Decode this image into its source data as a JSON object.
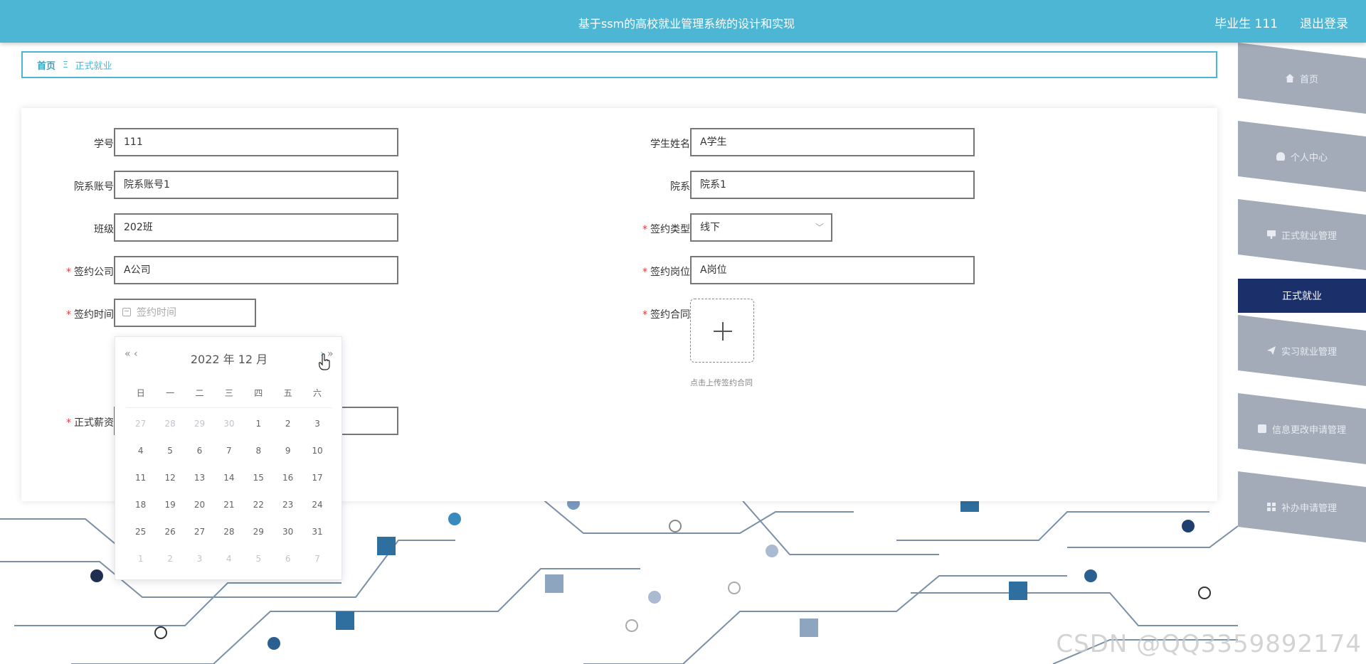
{
  "header": {
    "title": "基于ssm的高校就业管理系统的设计和实现",
    "user": "毕业生 111",
    "logout": "退出登录"
  },
  "breadcrumb": {
    "home": "首页",
    "separator": "Ξ",
    "current": "正式就业"
  },
  "form": {
    "student_no_label": "学号",
    "student_no": "111",
    "student_name_label": "学生姓名",
    "student_name": "A学生",
    "dept_account_label": "院系账号",
    "dept_account": "院系账号1",
    "dept_label": "院系",
    "dept": "院系1",
    "class_label": "班级",
    "class": "202班",
    "sign_type_label": "签约类型",
    "sign_type": "线下",
    "sign_company_label": "签约公司",
    "sign_company": "A公司",
    "sign_position_label": "签约岗位",
    "sign_position": "A岗位",
    "sign_time_label": "签约时间",
    "sign_time_placeholder": "签约时间",
    "contract_label": "签约合同",
    "contract_tip": "点击上传签约合同",
    "salary_label": "正式薪资",
    "required_mark": "*"
  },
  "datepicker": {
    "prev_year": "«",
    "prev_month": "‹",
    "next_month": "›",
    "next_year": "»",
    "title": "2022 年  12 月",
    "weekdays": [
      "日",
      "一",
      "二",
      "三",
      "四",
      "五",
      "六"
    ],
    "days": [
      {
        "d": "27",
        "muted": true
      },
      {
        "d": "28",
        "muted": true
      },
      {
        "d": "29",
        "muted": true
      },
      {
        "d": "30",
        "muted": true
      },
      {
        "d": "1"
      },
      {
        "d": "2"
      },
      {
        "d": "3"
      },
      {
        "d": "4"
      },
      {
        "d": "5"
      },
      {
        "d": "6"
      },
      {
        "d": "7"
      },
      {
        "d": "8"
      },
      {
        "d": "9"
      },
      {
        "d": "10"
      },
      {
        "d": "11"
      },
      {
        "d": "12"
      },
      {
        "d": "13"
      },
      {
        "d": "14"
      },
      {
        "d": "15"
      },
      {
        "d": "16"
      },
      {
        "d": "17"
      },
      {
        "d": "18"
      },
      {
        "d": "19"
      },
      {
        "d": "20"
      },
      {
        "d": "21"
      },
      {
        "d": "22"
      },
      {
        "d": "23"
      },
      {
        "d": "24"
      },
      {
        "d": "25"
      },
      {
        "d": "26"
      },
      {
        "d": "27"
      },
      {
        "d": "28"
      },
      {
        "d": "29"
      },
      {
        "d": "30"
      },
      {
        "d": "31"
      },
      {
        "d": "1",
        "muted": true
      },
      {
        "d": "2",
        "muted": true
      },
      {
        "d": "3",
        "muted": true
      },
      {
        "d": "4",
        "muted": true
      },
      {
        "d": "5",
        "muted": true
      },
      {
        "d": "6",
        "muted": true
      },
      {
        "d": "7",
        "muted": true
      }
    ]
  },
  "sidebar": {
    "items": [
      {
        "label": "首页",
        "icon": "home-icon"
      },
      {
        "label": "个人中心",
        "icon": "user-icon"
      },
      {
        "label": "正式就业管理",
        "icon": "document-icon"
      },
      {
        "label": "正式就业",
        "icon": ""
      },
      {
        "label": "实习就业管理",
        "icon": "send-icon"
      },
      {
        "label": "信息更改申请管理",
        "icon": "clipboard-icon"
      },
      {
        "label": "补办申请管理",
        "icon": "grid-icon"
      }
    ]
  },
  "watermark": "CSDN @QQ3359892174",
  "colors": {
    "header": "#4db6d5",
    "sidebar_item": "#a3abb8",
    "sidebar_active": "#1b2f6b",
    "required": "#e04040"
  }
}
